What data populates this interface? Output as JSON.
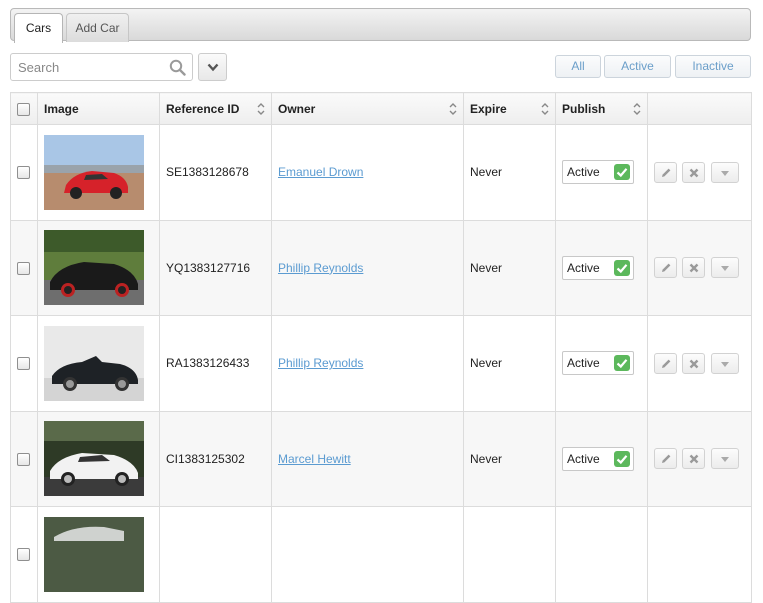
{
  "tabs": [
    {
      "label": "Cars",
      "active": true
    },
    {
      "label": "Add Car",
      "active": false
    }
  ],
  "search": {
    "placeholder": "Search",
    "value": ""
  },
  "filters": [
    "All",
    "Active",
    "Inactive"
  ],
  "table": {
    "columns": [
      "",
      "Image",
      "Reference ID",
      "Owner",
      "Expire",
      "Publish",
      ""
    ],
    "rows": [
      {
        "ref": "SE1383128678",
        "owner": "Emanuel Drown",
        "expire": "Never",
        "publish": "Active",
        "image": "red-sports-car"
      },
      {
        "ref": "YQ1383127716",
        "owner": "Phillip Reynolds",
        "expire": "Never",
        "publish": "Active",
        "image": "black-coupe"
      },
      {
        "ref": "RA1383126433",
        "owner": "Phillip Reynolds",
        "expire": "Never",
        "publish": "Active",
        "image": "black-convertible"
      },
      {
        "ref": "CI1383125302",
        "owner": "Marcel Hewitt",
        "expire": "Never",
        "publish": "Active",
        "image": "white-coupe"
      }
    ]
  },
  "colors": {
    "link": "#5b9bd1",
    "filter_text": "#6a9ec9",
    "publish_ok": "#5cb85c"
  },
  "icons": [
    "search-icon",
    "chevron-down-icon",
    "sort-icon",
    "checkmark-icon",
    "pencil-icon",
    "close-icon",
    "caret-down-icon"
  ]
}
